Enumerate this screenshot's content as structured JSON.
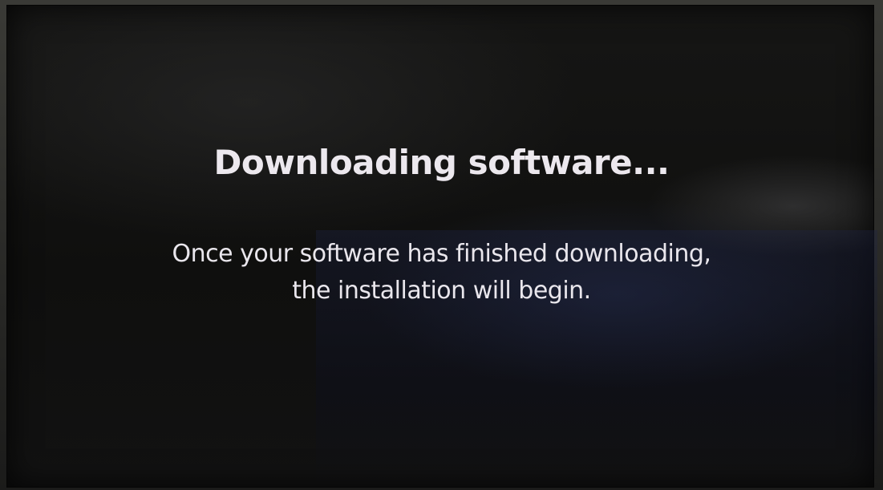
{
  "screen": {
    "title": "Downloading software...",
    "message_lines": [
      "Once your software has finished downloading,",
      "the installation will begin."
    ]
  },
  "colors": {
    "background": "#111110",
    "text": "#ece8ee"
  }
}
